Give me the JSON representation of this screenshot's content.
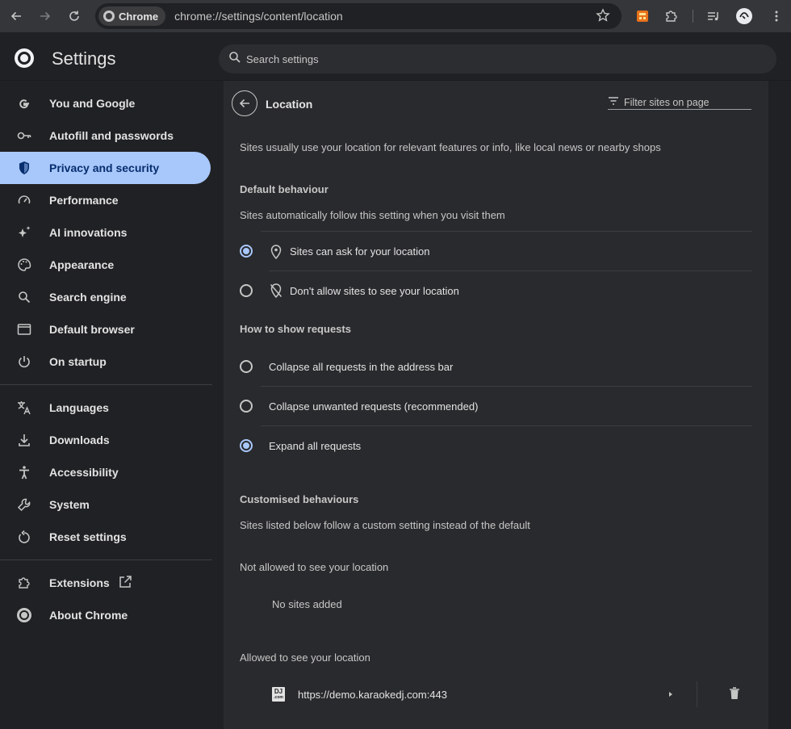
{
  "browser": {
    "chip_label": "Chrome",
    "url": "chrome://settings/content/location"
  },
  "header": {
    "title": "Settings",
    "search_placeholder": "Search settings"
  },
  "sidebar": {
    "items": [
      {
        "label": "You and Google",
        "icon": "google-g-icon"
      },
      {
        "label": "Autofill and passwords",
        "icon": "key-icon"
      },
      {
        "label": "Privacy and security",
        "icon": "shield-icon",
        "active": true
      },
      {
        "label": "Performance",
        "icon": "speedometer-icon"
      },
      {
        "label": "AI innovations",
        "icon": "sparkle-icon"
      },
      {
        "label": "Appearance",
        "icon": "palette-icon"
      },
      {
        "label": "Search engine",
        "icon": "search-icon"
      },
      {
        "label": "Default browser",
        "icon": "browser-window-icon"
      },
      {
        "label": "On startup",
        "icon": "power-icon"
      },
      {
        "label": "Languages",
        "icon": "translate-icon"
      },
      {
        "label": "Downloads",
        "icon": "download-icon"
      },
      {
        "label": "Accessibility",
        "icon": "accessibility-icon"
      },
      {
        "label": "System",
        "icon": "wrench-icon"
      },
      {
        "label": "Reset settings",
        "icon": "reset-icon"
      },
      {
        "label": "Extensions",
        "icon": "puzzle-icon"
      },
      {
        "label": "About Chrome",
        "icon": "chrome-icon"
      }
    ]
  },
  "page": {
    "title": "Location",
    "filter_placeholder": "Filter sites on page",
    "description": "Sites usually use your location for relevant features or info, like local news or nearby shops",
    "default_behaviour": {
      "heading": "Default behaviour",
      "subtext": "Sites automatically follow this setting when you visit them",
      "options": [
        {
          "label": "Sites can ask for your location",
          "checked": true
        },
        {
          "label": "Don't allow sites to see your location",
          "checked": false
        }
      ]
    },
    "requests": {
      "heading": "How to show requests",
      "options": [
        {
          "label": "Collapse all requests in the address bar",
          "checked": false
        },
        {
          "label": "Collapse unwanted requests (recommended)",
          "checked": false
        },
        {
          "label": "Expand all requests",
          "checked": true
        }
      ]
    },
    "custom": {
      "heading": "Customised behaviours",
      "subtext": "Sites listed below follow a custom setting instead of the default",
      "not_allowed_heading": "Not allowed to see your location",
      "not_allowed_empty": "No sites added",
      "allowed_heading": "Allowed to see your location",
      "allowed_sites": [
        {
          "url": "https://demo.karaokedj.com:443",
          "favicon_text": "DJ",
          "favicon_sub": ".com"
        }
      ]
    }
  },
  "colors": {
    "accent": "#a8c7fa",
    "background": "#202124",
    "card": "#292a2d"
  }
}
